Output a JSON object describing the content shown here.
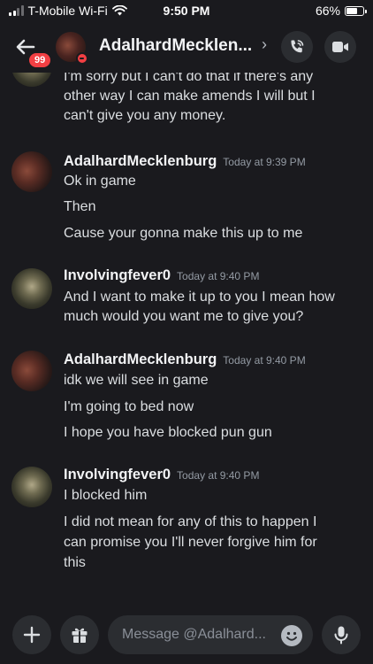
{
  "status_bar": {
    "carrier": "T-Mobile Wi-Fi",
    "time": "9:50 PM",
    "battery_text": "66%",
    "battery_level": 0.66
  },
  "header": {
    "back_icon": "back-arrow-icon",
    "unread_badge": "99",
    "title": "AdalhardMecklen...",
    "chevron": "›",
    "status": "do-not-disturb",
    "call_icon": "phone-call-icon",
    "video_icon": "video-camera-icon"
  },
  "messages": {
    "partial_prev": {
      "lines": [
        "I'm sorry but I can't do that if there's any",
        "other way I can make amends I will but I",
        "can't give you any money."
      ]
    },
    "groups": [
      {
        "author": "AdalhardMecklenburg",
        "timestamp": "Today at 9:39 PM",
        "lines": [
          "Ok in game",
          "Then",
          "Cause your gonna make this up to me"
        ]
      },
      {
        "author": "Involvingfever0",
        "timestamp": "Today at 9:40 PM",
        "lines": [
          "And I want to make it up to you I mean how",
          "much would you want me to give you?"
        ]
      },
      {
        "author": "AdalhardMecklenburg",
        "timestamp": "Today at 9:40 PM",
        "lines": [
          "idk we will see in game",
          "I'm going to bed now",
          "I hope you have blocked pun gun"
        ]
      },
      {
        "author": "Involvingfever0",
        "timestamp": "Today at 9:40 PM",
        "lines": [
          "I blocked him",
          "I did not mean for any of this to happen I",
          "can promise you I'll never forgive him for",
          "this"
        ]
      }
    ]
  },
  "input_bar": {
    "plus_icon": "plus-icon",
    "gift_icon": "gift-icon",
    "placeholder": "Message @Adalhard...",
    "emoji_icon": "emoji-icon",
    "mic_icon": "microphone-icon"
  },
  "colors": {
    "background": "#1a1a1e",
    "button_bg": "#2b2d31",
    "badge_red": "#f23f43",
    "text_primary": "#f2f3f5",
    "text_body": "#dbdee1",
    "text_muted": "#949ba4"
  }
}
